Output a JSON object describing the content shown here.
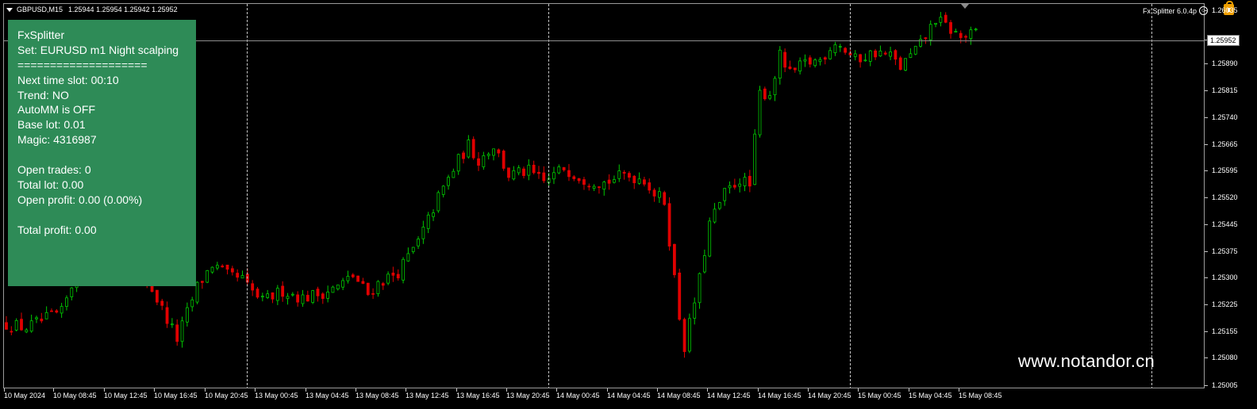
{
  "header": {
    "symbol": "GBPUSD,M15",
    "quotes": "1.25944 1.25954 1.25942 1.25952"
  },
  "indicator_label": "Fx Splitter 6.0.4p",
  "info_panel": {
    "lines": [
      "FxSplitter",
      "Set: EURUSD m1 Night scalping",
      "====================",
      "Next time slot: 00:10",
      "Trend: NO",
      "AutoMM is OFF",
      "Base lot: 0.01",
      "Magic: 4316987",
      "",
      "Open trades: 0",
      "Total lot: 0.00",
      "Open profit: 0.00 (0.00%)",
      "",
      "Total profit: 0.00"
    ]
  },
  "watermark": "www.notandor.cn",
  "price_axis": {
    "labels": [
      "1.26035",
      "1.25965",
      "1.25890",
      "1.25815",
      "1.25740",
      "1.25665",
      "1.25595",
      "1.25520",
      "1.25445",
      "1.25375",
      "1.25300",
      "1.25225",
      "1.25155",
      "1.25080",
      "1.25005"
    ],
    "current_price": "1.25952"
  },
  "time_axis": {
    "labels": [
      "10 May 2024",
      "10 May 08:45",
      "10 May 12:45",
      "10 May 16:45",
      "10 May 20:45",
      "13 May 00:45",
      "13 May 04:45",
      "13 May 08:45",
      "13 May 12:45",
      "13 May 16:45",
      "13 May 20:45",
      "14 May 00:45",
      "14 May 04:45",
      "14 May 08:45",
      "14 May 12:45",
      "14 May 16:45",
      "14 May 20:45",
      "15 May 00:45",
      "15 May 04:45",
      "15 May 08:45"
    ]
  },
  "colors": {
    "background": "#000000",
    "bull": "#00c800",
    "bear": "#e00000",
    "panel": "#2e8b57"
  },
  "chart_data": {
    "type": "candlestick",
    "ylim": [
      1.25005,
      1.2604
    ],
    "close_path": [
      [
        0,
        1.2518
      ],
      [
        4,
        1.2517
      ],
      [
        9,
        1.252
      ],
      [
        11,
        1.2521
      ],
      [
        14,
        1.2532
      ],
      [
        17,
        1.2534
      ],
      [
        24,
        1.2531
      ],
      [
        28,
        1.253
      ],
      [
        31,
        1.2522
      ],
      [
        34,
        1.2514
      ],
      [
        38,
        1.2528
      ],
      [
        41,
        1.2534
      ],
      [
        44,
        1.2531
      ],
      [
        47,
        1.253
      ],
      [
        48,
        1.2528
      ],
      [
        51,
        1.2524
      ],
      [
        55,
        1.2527
      ],
      [
        59,
        1.2525
      ],
      [
        62,
        1.2526
      ],
      [
        66,
        1.2528
      ],
      [
        69,
        1.2531
      ],
      [
        72,
        1.2526
      ],
      [
        74,
        1.2529
      ],
      [
        78,
        1.2532
      ],
      [
        82,
        1.254
      ],
      [
        86,
        1.2552
      ],
      [
        90,
        1.2562
      ],
      [
        92,
        1.2566
      ],
      [
        94,
        1.2562
      ],
      [
        97,
        1.2566
      ],
      [
        100,
        1.2558
      ],
      [
        104,
        1.2559
      ],
      [
        107,
        1.2556
      ],
      [
        111,
        1.256
      ],
      [
        115,
        1.2557
      ],
      [
        119,
        1.2556
      ],
      [
        123,
        1.2558
      ],
      [
        127,
        1.2557
      ],
      [
        129,
        1.2553
      ],
      [
        131,
        1.2551
      ],
      [
        134,
        1.252
      ],
      [
        135,
        1.2512
      ],
      [
        138,
        1.253
      ],
      [
        140,
        1.2545
      ],
      [
        143,
        1.2553
      ],
      [
        146,
        1.2557
      ],
      [
        148,
        1.2555
      ],
      [
        150,
        1.258
      ],
      [
        152,
        1.258
      ],
      [
        154,
        1.259
      ],
      [
        156,
        1.2585
      ],
      [
        159,
        1.2588
      ],
      [
        162,
        1.2589
      ],
      [
        165,
        1.2594
      ],
      [
        169,
        1.2589
      ],
      [
        173,
        1.2591
      ],
      [
        176,
        1.259
      ],
      [
        178,
        1.2587
      ],
      [
        182,
        1.2593
      ],
      [
        185,
        1.26
      ],
      [
        187,
        1.2598
      ],
      [
        190,
        1.2595
      ],
      [
        193,
        1.2596
      ]
    ]
  }
}
